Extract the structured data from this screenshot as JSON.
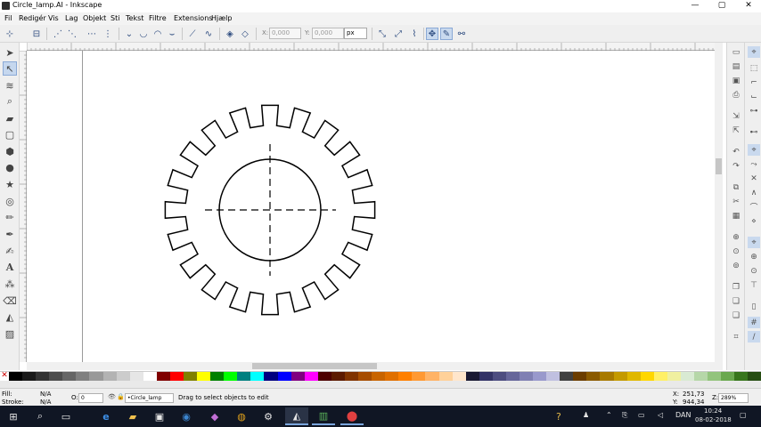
{
  "window": {
    "title": "Circle_lamp.AI - Inkscape",
    "controls": {
      "minimize": "—",
      "maximize": "▢",
      "close": "✕"
    }
  },
  "menu": [
    "Fil",
    "Redigér",
    "Vis",
    "Lag",
    "Objekt",
    "Sti",
    "Tekst",
    "Filtre",
    "Extensions",
    "Hjælp"
  ],
  "toolctrl": {
    "x_label": "X:",
    "x_value": "0,000",
    "y_label": "Y:",
    "y_value": "0,000",
    "unit": "px"
  },
  "status": {
    "fill_label": "Fill:",
    "fill_value": "N/A",
    "stroke_label": "Stroke:",
    "stroke_value": "N/A",
    "opacity_label": "O:",
    "opacity_value": "0",
    "layer": "•Circle_lamp",
    "message": "Drag to select objects to edit",
    "cursor_x_label": "X:",
    "cursor_x": "251,73",
    "cursor_y_label": "Y:",
    "cursor_y": "944,34",
    "zoom_label": "Z:",
    "zoom": "289%"
  },
  "taskbar": {
    "language": "DAN",
    "time": "10:24",
    "date": "08-02-2018"
  },
  "colors": {
    "palette": [
      "#000000",
      "#1a1a1a",
      "#333333",
      "#4d4d4d",
      "#666666",
      "#808080",
      "#999999",
      "#b3b3b3",
      "#cccccc",
      "#e6e6e6",
      "#ffffff",
      "#800000",
      "#ff0000",
      "#808000",
      "#ffff00",
      "#008000",
      "#00ff00",
      "#008080",
      "#00ffff",
      "#000080",
      "#0000ff",
      "#800080",
      "#ff00ff",
      "#4d0000",
      "#5c1a00",
      "#803300",
      "#a64d00",
      "#c86400",
      "#e07000",
      "#ff8000",
      "#ff9933",
      "#ffb366",
      "#ffd199",
      "#ffe6cc",
      "#1a1a33",
      "#333366",
      "#4d4d80",
      "#66669a",
      "#8080b3",
      "#9999cc",
      "#c0c0e0",
      "#404040",
      "#6b3d00",
      "#8a5a00",
      "#a87a00",
      "#c49a00",
      "#e0b800",
      "#ffd700",
      "#fff066",
      "#f0f0a0",
      "#d9ead3",
      "#b6d7a8",
      "#93c47d",
      "#6aa84f",
      "#38761d",
      "#274e13"
    ]
  }
}
